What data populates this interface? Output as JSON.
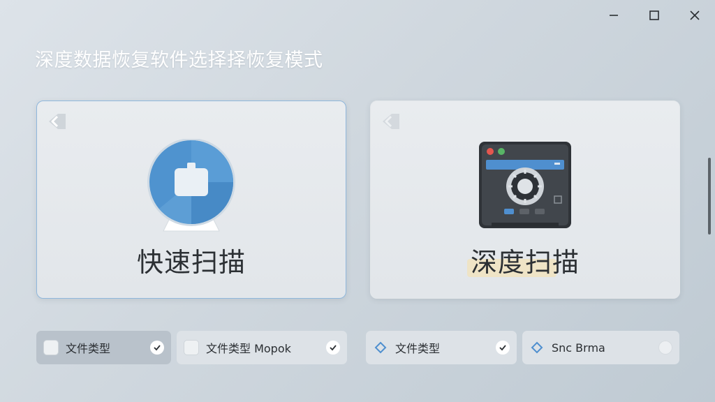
{
  "window": {
    "minimize_icon": "minimize-icon",
    "maximize_icon": "maximize-icon",
    "close_icon": "close-icon"
  },
  "page": {
    "title": "深度数据恢复软件选择择恢复模式"
  },
  "modes": [
    {
      "label": "快速扫描",
      "icon": "quick-scan-disk-icon",
      "selected": true
    },
    {
      "label": "深度扫描",
      "icon": "deep-scan-safe-icon",
      "selected": false
    }
  ],
  "options": [
    {
      "label": "文件类型",
      "indicator": "checkbox",
      "state": "checked",
      "active": true
    },
    {
      "label": "文件类型 Mopok",
      "indicator": "checkbox",
      "state": "checked",
      "active": false
    },
    {
      "label": "文件类型",
      "indicator": "diamond-icon",
      "state": "checked",
      "active": false
    },
    {
      "label": "Snc Brma",
      "indicator": "diamond-icon",
      "state": "unchecked",
      "active": false
    }
  ],
  "colors": {
    "accent_blue": "#4f93cf",
    "card_border_selected": "#8fb7dc",
    "safe_body": "#3b3f44"
  }
}
